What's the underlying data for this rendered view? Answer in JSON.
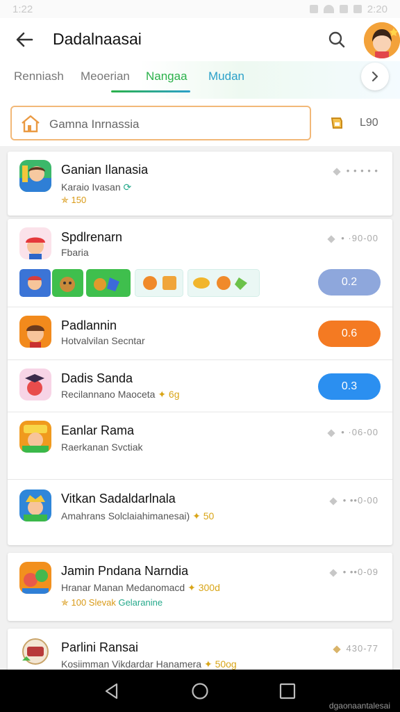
{
  "status_bar": {
    "time": "1:22",
    "right_time": "2:20"
  },
  "header": {
    "title": "Dadalnaasai"
  },
  "tabs": [
    {
      "label": "Renniash"
    },
    {
      "label": "Meoerian"
    },
    {
      "label": "Nangaa"
    },
    {
      "label": "Mudan"
    }
  ],
  "search": {
    "text": "Gamna Inrnassia",
    "filter_label": "L90"
  },
  "cards": [
    {
      "rows": [
        {
          "name": "Ganian Ilanasia",
          "sub": "Karaio Ivasan",
          "meta": "✯ 150",
          "right": "• • • • •"
        }
      ]
    },
    {
      "rows": [
        {
          "name": "Spdlrenarn",
          "sub": "Fbaria",
          "right": "• ·90-00",
          "pill": "0.2"
        },
        {
          "name": "Padlannin",
          "sub": "Hotvalvilan Secntar",
          "pill": "0.6"
        },
        {
          "name": "Dadis Sanda",
          "sub": "Recilannano Maoceta",
          "sub_extra": "✦ 6g",
          "pill": "0.3"
        },
        {
          "name": "Eanlar Rama",
          "sub": "Raerkanan Svctiak",
          "right": "• ·06-00"
        },
        {
          "name": "Vitkan Sadaldarlnala",
          "sub": "Amahrans Solclaiahimanesai)",
          "sub_extra": "✦ 50",
          "right": "• ••0-00"
        }
      ]
    },
    {
      "rows": [
        {
          "name": "Jamin Pndana Narndia",
          "sub": "Hranar Manan Medanomacd",
          "sub_extra": "✦ 300d",
          "meta": "✯ 100 Slevak",
          "meta_teal": "Gelaranine",
          "right": "• ••0-09"
        }
      ]
    },
    {
      "rows": [
        {
          "name": "Parlini Ransai",
          "sub": "Kosiimman Vikdardar Hanamera",
          "sub_extra": "✦ 50og",
          "right": "430-77"
        }
      ]
    }
  ],
  "nav": {
    "watermark": "dgaonaantalesai"
  },
  "colors": {
    "accent_green": "#2bb14a",
    "accent_teal": "#2ba0c9",
    "orange": "#f47a22",
    "blue": "#2b8ff0",
    "search_border": "#f2b878"
  },
  "icons": [
    "back-arrow-icon",
    "search-icon",
    "chevron-right-icon",
    "home-icon",
    "filter-icon",
    "star-icon",
    "sync-icon",
    "nav-back-icon",
    "nav-home-icon",
    "nav-recents-icon"
  ]
}
